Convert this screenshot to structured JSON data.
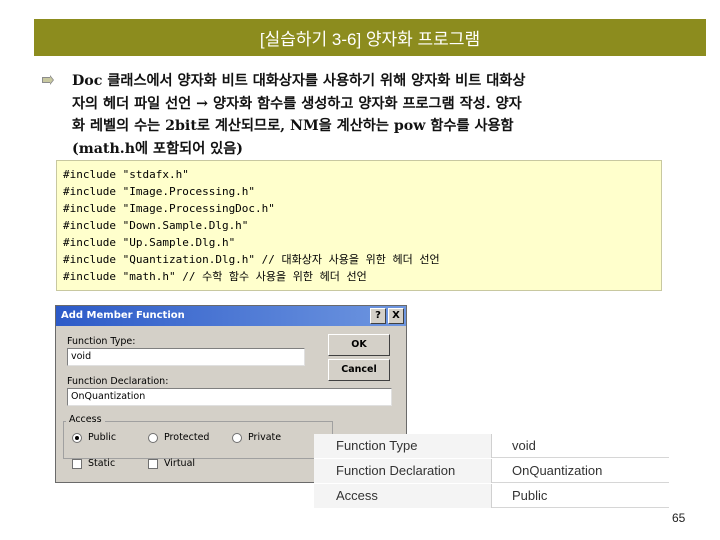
{
  "slide": {
    "title": "[실습하기 3-6] 양자화 프로그램",
    "bullet_text": "Doc 클래스에서 양자화 비트 대화상자를 사용하기 위해 양자화 비트 대화상\n자의 헤더 파일 선언 → 양자화 함수를 생성하고 양자화 프로그램 작성.  양자\n화 레벨의 수는 2bit로 계산되므로, NM을 계산하는 pow 함수를 사용함\n(math.h에 포함되어 있음)",
    "code_lines": [
      "#include \"stdafx.h\"",
      "#include \"Image.Processing.h\"",
      "#include \"Image.ProcessingDoc.h\"",
      "#include \"Down.Sample.Dlg.h\"",
      "#include \"Up.Sample.Dlg.h\"",
      "#include \"Quantization.Dlg.h\" // 대화상자 사용을 위한 헤더 선언",
      "#include \"math.h\" // 수학 함수 사용을 위한 헤더 선언"
    ],
    "page_number": "65"
  },
  "dialog": {
    "title": "Add Member Function",
    "help_btn": "?",
    "close_btn": "X",
    "function_type_label": "Function Type:",
    "function_type_value": "void",
    "function_decl_label": "Function Declaration:",
    "function_decl_value": "OnQuantization",
    "ok_label": "OK",
    "cancel_label": "Cancel",
    "access_label": "Access",
    "access_options": [
      "Public",
      "Protected",
      "Private"
    ],
    "static_label": "Static",
    "virtual_label": "Virtual"
  },
  "info_table": {
    "rows": [
      {
        "key": "Function Type",
        "value": "void"
      },
      {
        "key": "Function Declaration",
        "value": "OnQuantization"
      },
      {
        "key": "Access",
        "value": "Public"
      }
    ]
  },
  "colors": {
    "title_bar": "#8c8c1e",
    "code_bg": "#ffffcc",
    "dialog_bg": "#d4d0c8",
    "dialog_title": "#2c5ac8"
  }
}
